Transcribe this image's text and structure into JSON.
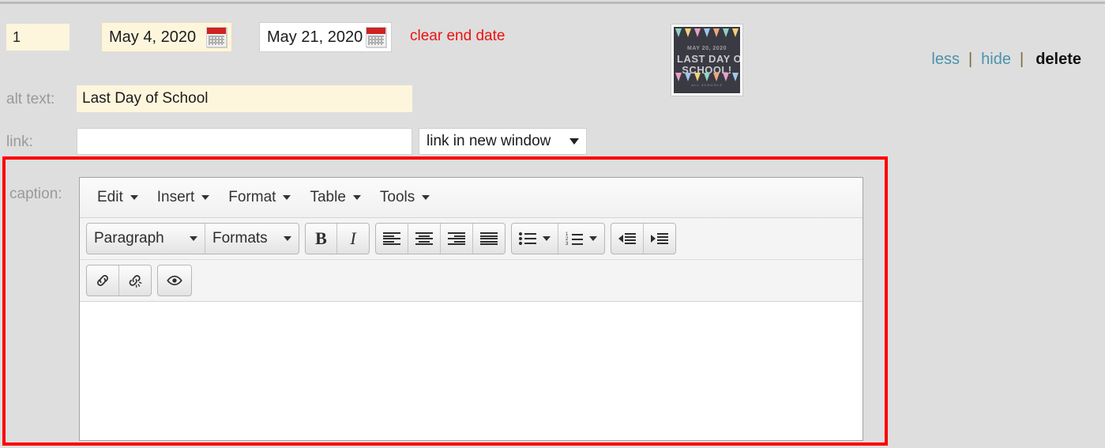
{
  "row": {
    "order_value": "1",
    "start_date": "May 4, 2020",
    "end_date": "May 21, 2020",
    "clear_end_date_label": "clear end date",
    "start_date_icon": "calendar-icon",
    "end_date_icon": "calendar-icon"
  },
  "thumbnail": {
    "alt": "Last Day of School",
    "line_date": "MAY 20, 2020",
    "line_big_1": "LAST DAY OF",
    "line_big_2": "SCHOOL!",
    "line_small": "ALL SCHOOLS"
  },
  "actions": {
    "less_label": "less",
    "hide_label": "hide",
    "delete_label": "delete",
    "separator": "|"
  },
  "fields": {
    "alt_text_label": "alt text:",
    "alt_text_value": "Last Day of School",
    "alt_text_placeholder": "",
    "link_label": "link:",
    "link_value": "",
    "link_placeholder": "",
    "link_target_selected": "link in new window",
    "caption_label": "caption:"
  },
  "editor": {
    "menubar": [
      {
        "label": "Edit"
      },
      {
        "label": "Insert"
      },
      {
        "label": "Format"
      },
      {
        "label": "Table"
      },
      {
        "label": "Tools"
      }
    ],
    "block_format": "Paragraph",
    "styles_format": "Formats",
    "bold_label": "B",
    "italic_label": "I",
    "icons": {
      "align_left": "align-left-icon",
      "align_center": "align-center-icon",
      "align_right": "align-right-icon",
      "align_justify": "align-justify-icon",
      "bullet_list": "unordered-list-icon",
      "numbered_list": "ordered-list-icon",
      "outdent": "outdent-icon",
      "indent": "indent-icon",
      "link": "link-icon",
      "unlink": "unlink-icon",
      "preview": "preview-eye-icon"
    },
    "content": ""
  },
  "colors": {
    "page_background": "#dedede",
    "highlight_field": "#fdf6dd",
    "danger_text": "#ee1111",
    "caption_outline": "#ff0000",
    "link_text": "#4a93ad",
    "label_text": "#9a9a9a",
    "calendar_header": "#cf2222"
  }
}
